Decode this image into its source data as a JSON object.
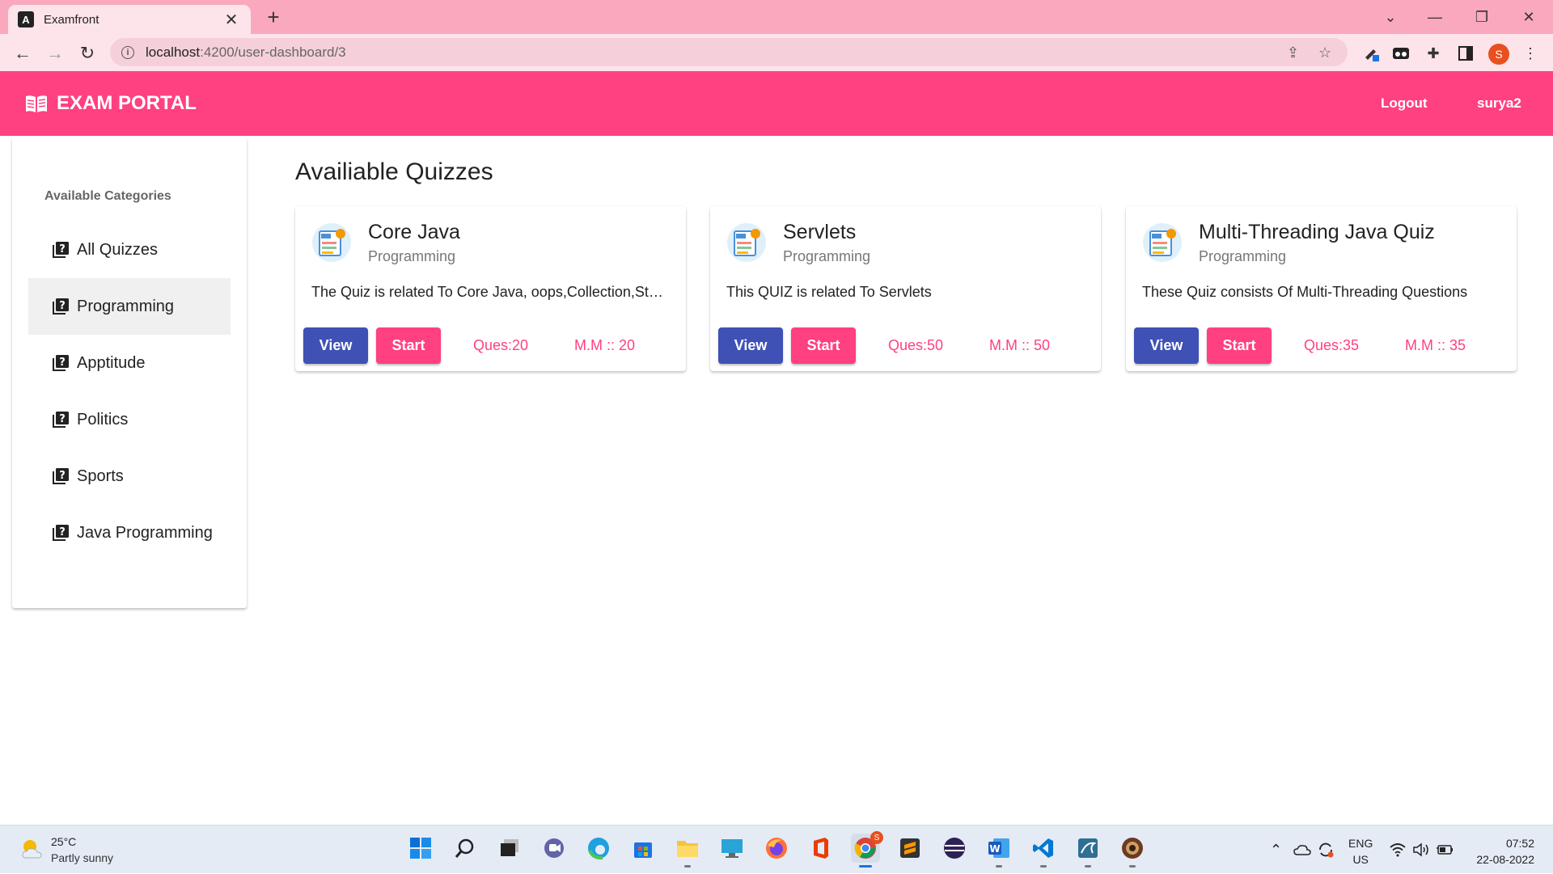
{
  "browser": {
    "tab_title": "Examfront",
    "tab_favicon": "A",
    "url_host": "localhost",
    "url_path": ":4200/user-dashboard/3",
    "profile_initial": "S"
  },
  "navbar": {
    "brand": "EXAM PORTAL",
    "logout_label": "Logout",
    "username": "surya2"
  },
  "sidebar": {
    "heading": "Available Categories",
    "items": [
      {
        "label": "All Quizzes"
      },
      {
        "label": "Programming"
      },
      {
        "label": "Apptitude"
      },
      {
        "label": "Politics"
      },
      {
        "label": "Sports"
      },
      {
        "label": "Java Programming"
      }
    ],
    "active_index": 1
  },
  "main": {
    "title": "Availiable Quizzes",
    "view_label": "View",
    "start_label": "Start",
    "quizzes": [
      {
        "title": "Core Java",
        "category": "Programming",
        "description": "The Quiz is related To Core Java, oops,Collection,Strea...",
        "questions": "Ques:20",
        "max_marks": "M.M :: 20"
      },
      {
        "title": "Servlets",
        "category": "Programming",
        "description": "This QUIZ is related To Servlets",
        "questions": "Ques:50",
        "max_marks": "M.M :: 50"
      },
      {
        "title": "Multi-Threading Java Quiz",
        "category": "Programming",
        "description": "These Quiz consists Of Multi-Threading Questions",
        "questions": "Ques:35",
        "max_marks": "M.M :: 35"
      }
    ]
  },
  "taskbar": {
    "weather_temp": "25°C",
    "weather_condition": "Partly sunny",
    "language": "ENG",
    "region": "US",
    "time": "07:52",
    "date": "22-08-2022",
    "chrome_badge": "S"
  },
  "colors": {
    "tabbar": "#f9a8bd",
    "toolbar": "#fde4ea",
    "primary_pink": "#ff4081",
    "indigo": "#3f51b5"
  }
}
